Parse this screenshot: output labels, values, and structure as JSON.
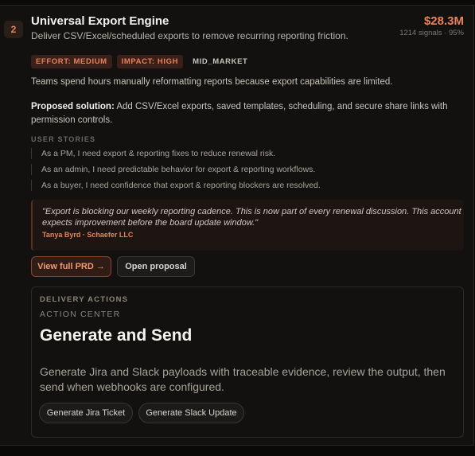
{
  "item": {
    "rank": "2",
    "title": "Universal Export Engine",
    "subtitle": "Deliver CSV/Excel/scheduled exports to remove recurring reporting friction.",
    "amount": "$28.3M",
    "signals": "1214 signals · 95%",
    "tags": {
      "effort": "EFFORT: MEDIUM",
      "impact": "IMPACT: HIGH",
      "segment": "MID_MARKET"
    },
    "problem": "Teams spend hours manually reformatting reports because export capabilities are limited.",
    "solution_label": "Proposed solution:",
    "solution_text": " Add CSV/Excel exports, saved templates, scheduling, and secure share links with permission controls.",
    "stories_heading": "USER STORIES",
    "stories": [
      "As a PM, I need export & reporting fixes to reduce renewal risk.",
      "As an admin, I need predictable behavior for export & reporting workflows.",
      "As a buyer, I need confidence that export & reporting blockers are resolved."
    ],
    "quote": "\"Export is blocking our weekly reporting cadence. This is now part of every renewal discussion. This account expects improvement before the board update window.\"",
    "quote_attribution": "Tanya Byrd · Schaefer LLC",
    "view_prd_label": "View full PRD →",
    "open_proposal_label": "Open proposal"
  },
  "delivery": {
    "label": "DELIVERY ACTIONS",
    "kicker": "ACTION CENTER",
    "title": "Generate and Send",
    "description": "Generate Jira and Slack payloads with traceable evidence, review the output, then send when webhooks are configured.",
    "jira_button": "Generate Jira Ticket",
    "slack_button": "Generate Slack Update"
  },
  "colors": {
    "accent": "#e8825a",
    "background": "#0a0908"
  }
}
